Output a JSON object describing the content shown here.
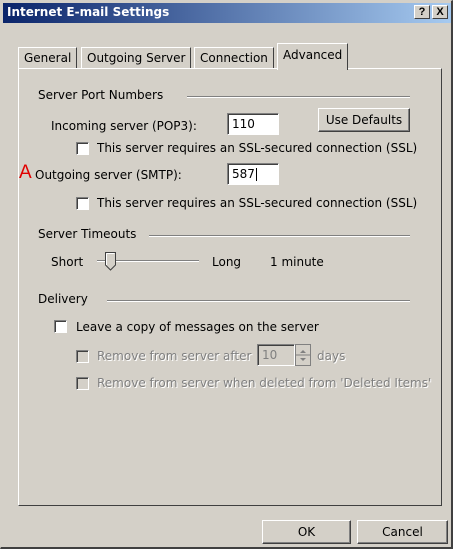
{
  "window": {
    "title": "Internet E-mail Settings",
    "help_glyph": "?",
    "close_glyph": "X"
  },
  "tabs": [
    {
      "label": "General"
    },
    {
      "label": "Outgoing Server"
    },
    {
      "label": "Connection"
    },
    {
      "label": "Advanced",
      "active": true
    }
  ],
  "server_ports": {
    "group_label": "Server Port Numbers",
    "incoming_label": "Incoming server (POP3):",
    "incoming_value": "110",
    "use_defaults_label": "Use Defaults",
    "incoming_ssl_label": "This server requires an SSL-secured connection (SSL)",
    "annotation_marker": "A",
    "outgoing_label": "Outgoing server (SMTP):",
    "outgoing_value": "587",
    "outgoing_ssl_label": "This server requires an SSL-secured connection (SSL)"
  },
  "timeouts": {
    "group_label": "Server Timeouts",
    "short_label": "Short",
    "long_label": "Long",
    "value_label": "1 minute"
  },
  "delivery": {
    "group_label": "Delivery",
    "leave_copy_label": "Leave a copy of messages on the server",
    "remove_after_label": "Remove from server after",
    "remove_after_value": "10",
    "days_label": "days",
    "remove_deleted_label": "Remove from server when deleted from 'Deleted Items'"
  },
  "footer": {
    "ok_label": "OK",
    "cancel_label": "Cancel"
  },
  "colors": {
    "title_gradient_start": "#0a246a",
    "title_gradient_end": "#a6caf0",
    "face": "#d4d0c8",
    "annotation": "#e00000"
  }
}
